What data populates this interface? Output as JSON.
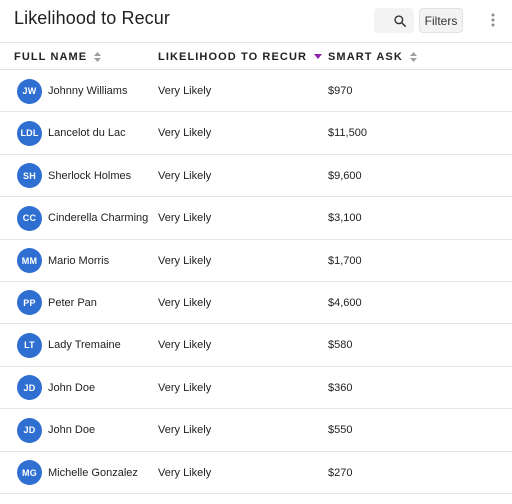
{
  "header": {
    "title": "Likelihood to Recur",
    "filters_label": "Filters"
  },
  "columns": {
    "name": "FULL NAME",
    "likelihood": "LIKELIHOOD TO RECUR",
    "ask": "SMART ASK"
  },
  "colors": {
    "avatar": "#2f6fd1",
    "sort_active": "#8e24aa",
    "sort_inactive": "#9e9e9e"
  },
  "rows": [
    {
      "initials": "JW",
      "name": "Johnny Williams",
      "likelihood": "Very Likely",
      "ask": "$970"
    },
    {
      "initials": "LDL",
      "name": "Lancelot du Lac",
      "likelihood": "Very Likely",
      "ask": "$11,500"
    },
    {
      "initials": "SH",
      "name": "Sherlock Holmes",
      "likelihood": "Very Likely",
      "ask": "$9,600"
    },
    {
      "initials": "CC",
      "name": "Cinderella Charming",
      "likelihood": "Very Likely",
      "ask": "$3,100"
    },
    {
      "initials": "MM",
      "name": "Mario Morris",
      "likelihood": "Very Likely",
      "ask": "$1,700"
    },
    {
      "initials": "PP",
      "name": "Peter Pan",
      "likelihood": "Very Likely",
      "ask": "$4,600"
    },
    {
      "initials": "LT",
      "name": "Lady Tremaine",
      "likelihood": "Very Likely",
      "ask": "$580"
    },
    {
      "initials": "JD",
      "name": "John Doe",
      "likelihood": "Very Likely",
      "ask": "$360"
    },
    {
      "initials": "JD",
      "name": "John Doe",
      "likelihood": "Very Likely",
      "ask": "$550"
    },
    {
      "initials": "MG",
      "name": "Michelle Gonzalez",
      "likelihood": "Very Likely",
      "ask": "$270"
    }
  ]
}
